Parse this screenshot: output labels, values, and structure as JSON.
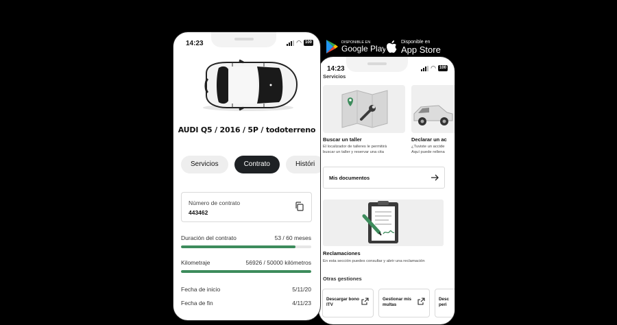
{
  "store_badges": {
    "google_play": {
      "small": "DISPONIBLE EN",
      "big": "Google Play"
    },
    "app_store": {
      "small": "Disponible en",
      "big": "App Store"
    }
  },
  "phone1": {
    "time": "14:23",
    "battery": "100",
    "car_title": "AUDI Q5 / 2016 / 5P / todoterreno",
    "tabs": [
      "Servicios",
      "Contrato",
      "Históri"
    ],
    "active_tab": "Contrato",
    "contract": {
      "label": "Número de contrato",
      "value": "443462"
    },
    "duration": {
      "label": "Duración del contrato",
      "value": "53 / 60 meses",
      "progress": 0.88
    },
    "mileage": {
      "label": "Kilometraje",
      "value": "56926 / 50000 kilómetros",
      "progress": 1.0
    },
    "start_date": {
      "label": "Fecha de inicio",
      "value": "5/11/20"
    },
    "end_date": {
      "label": "Fecha de fin",
      "value": "4/11/23"
    },
    "colors": {
      "accent": "#3d8c5c",
      "active_tab": "#1e2124"
    }
  },
  "phone2": {
    "time": "14:23",
    "battery": "100",
    "services_heading": "Servicios",
    "services": [
      {
        "title": "Buscar un taller",
        "desc_line1": "El localizador de talleres le permitirá",
        "desc_line2": "buscar un taller y reservar una cita",
        "icon": "map-wrench-icon"
      },
      {
        "title": "Declarar un ac",
        "desc_line1": "¿Tuviste un accide",
        "desc_line2": "Aquí puede rellena",
        "icon": "car-icon"
      }
    ],
    "documents_label": "Mis documentos",
    "claims": {
      "title": "Reclamaciones",
      "desc": "En esta sección puedes consultar y abrir una reclamación",
      "icon": "clipboard-signature-icon"
    },
    "other_heading": "Otras gestiones",
    "other_items": [
      {
        "line1": "Descargar bono",
        "line2": "ITV"
      },
      {
        "line1": "Gestionar mis",
        "line2": "multas"
      },
      {
        "line1": "Desc",
        "line2": "peri"
      }
    ]
  }
}
